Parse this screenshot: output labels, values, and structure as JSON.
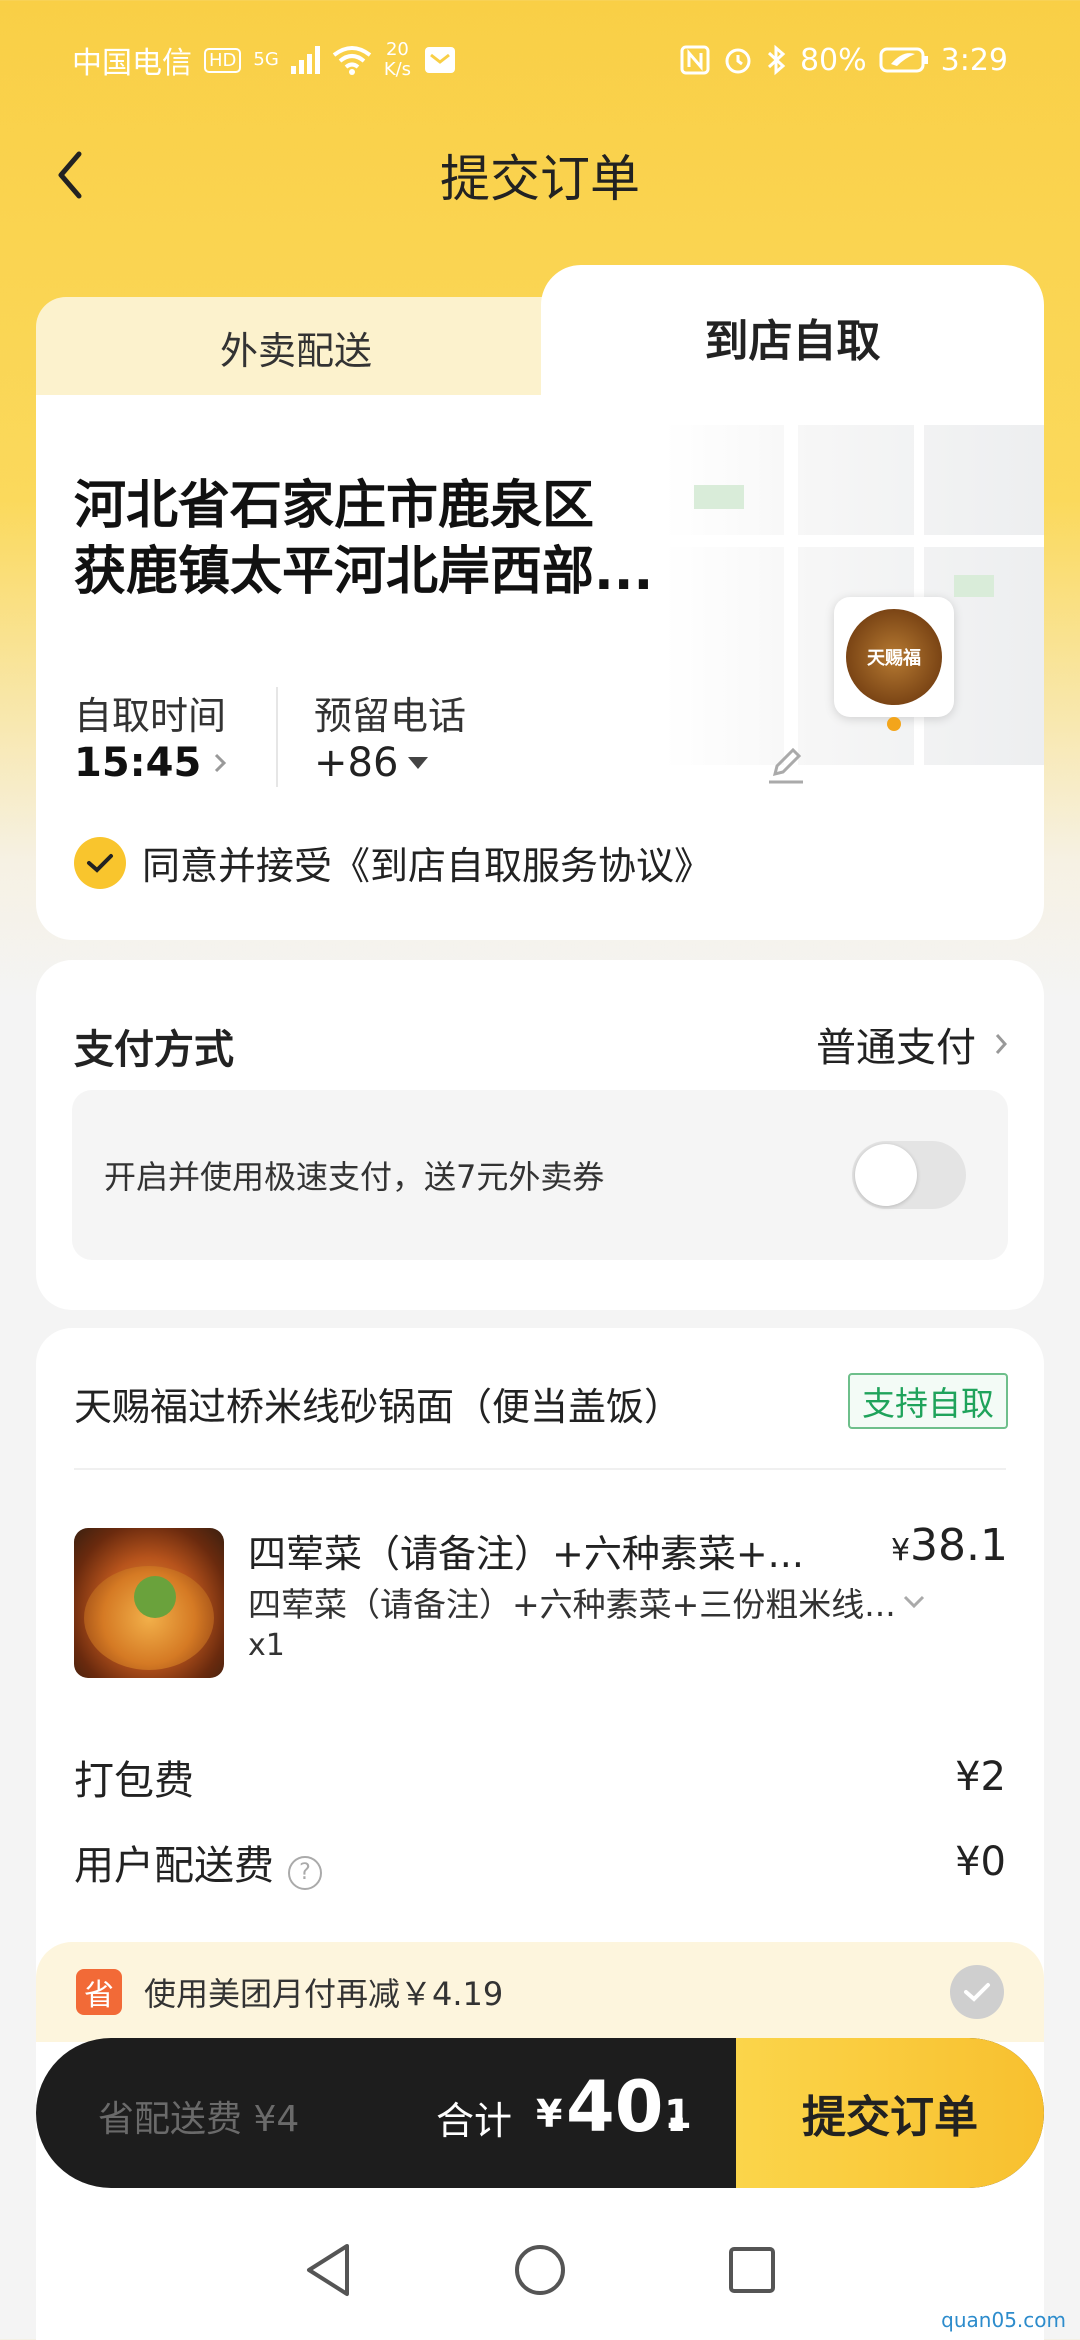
{
  "status_bar": {
    "carrier": "中国电信",
    "hd": "HD",
    "net_type": "5G",
    "speed_value": "20",
    "speed_unit": "K/s",
    "battery": "80%",
    "time": "3:29"
  },
  "header": {
    "title": "提交订单"
  },
  "tabs": {
    "delivery": "外卖配送",
    "pickup": "到店自取"
  },
  "pickup_card": {
    "address_line1": "河北省石家庄市鹿泉区",
    "address_line2": "获鹿镇太平河北岸西部...",
    "store_logo_text": "天赐福",
    "pickup_time_label": "自取时间",
    "pickup_time": "15:45",
    "phone_label": "预留电话",
    "phone_prefix": "+86",
    "agreement": "同意并接受《到店自取服务协议》",
    "agreement_checked": true
  },
  "payment": {
    "title": "支付方式",
    "method": "普通支付",
    "fast_pay_text": "开启并使用极速支付，送7元外卖券",
    "fast_pay_enabled": false
  },
  "order": {
    "shop_name": "天赐福过桥米线砂锅面（便当盖饭）",
    "pickup_tag": "支持自取",
    "items": [
      {
        "name": "四荤菜（请备注）+六种素菜+...",
        "spec": "四荤菜（请备注）+六种素菜+三份粗米线...",
        "qty": "x1",
        "currency": "¥",
        "price": "38.1"
      }
    ],
    "packing_fee_label": "打包费",
    "packing_fee": "¥2",
    "delivery_fee_label": "用户配送费",
    "delivery_fee": "¥0"
  },
  "monthly_pay": {
    "icon_text": "省",
    "text": "使用美团月付再减￥4.19"
  },
  "bottom_bar": {
    "saving": "省配送费 ¥4",
    "total_label": "合计",
    "currency": "¥",
    "total_int": "40.",
    "total_dec": "1",
    "submit": "提交订单"
  },
  "watermark": "quan05.com",
  "colors": {
    "brand_yellow": "#f9c52d",
    "dark_bar": "#1d1d1d",
    "pickup_tag_green": "#1fa35b",
    "promo_orange": "#f26a37"
  }
}
